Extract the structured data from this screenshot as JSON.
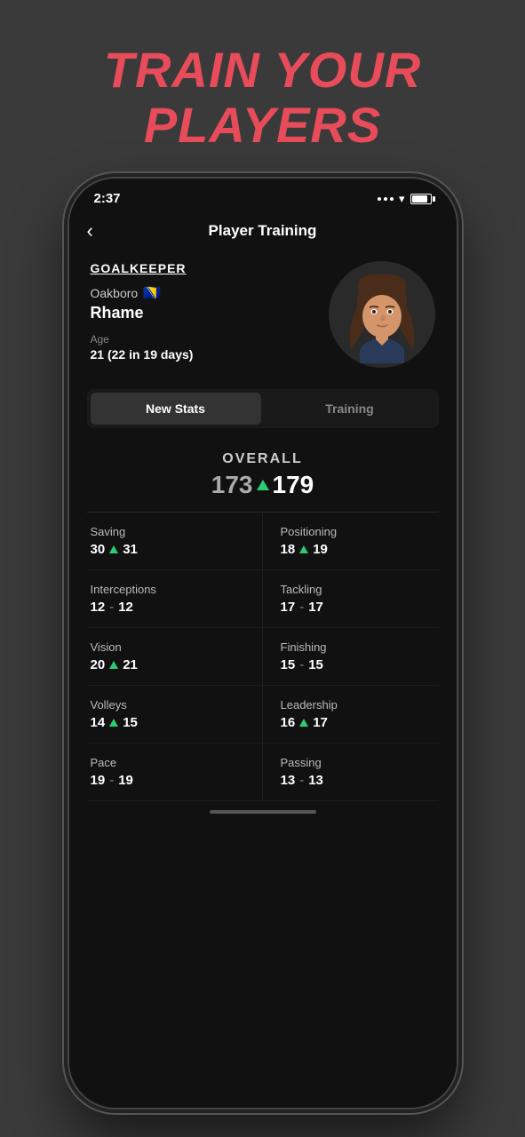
{
  "page": {
    "headline_line1": "TRAIN YOUR",
    "headline_line2": "PLAYERS"
  },
  "status_bar": {
    "time": "2:37",
    "battery_pct": 85
  },
  "nav": {
    "title": "Player Training",
    "back_label": "‹"
  },
  "player": {
    "position": "GOALKEEPER",
    "club": "Oakboro",
    "player_name": "Rhame",
    "age_label": "Age",
    "age_value": "21 (22 in 19 days)"
  },
  "tabs": {
    "new_stats": "New Stats",
    "training": "Training"
  },
  "overall": {
    "label": "OVERALL",
    "old_value": "173",
    "new_value": "179"
  },
  "stats": [
    {
      "name": "Saving",
      "old": "30",
      "new": "31",
      "changed": true
    },
    {
      "name": "Positioning",
      "old": "18",
      "new": "19",
      "changed": true
    },
    {
      "name": "Interceptions",
      "old": "12",
      "new": "12",
      "changed": false
    },
    {
      "name": "Tackling",
      "old": "17",
      "new": "17",
      "changed": false
    },
    {
      "name": "Vision",
      "old": "20",
      "new": "21",
      "changed": true
    },
    {
      "name": "Finishing",
      "old": "15",
      "new": "15",
      "changed": false
    },
    {
      "name": "Volleys",
      "old": "14",
      "new": "15",
      "changed": true
    },
    {
      "name": "Leadership",
      "old": "16",
      "new": "17",
      "changed": true
    },
    {
      "name": "Pace",
      "old": "19",
      "new": "19",
      "changed": false
    },
    {
      "name": "Passing",
      "old": "13",
      "new": "13",
      "changed": false
    }
  ]
}
